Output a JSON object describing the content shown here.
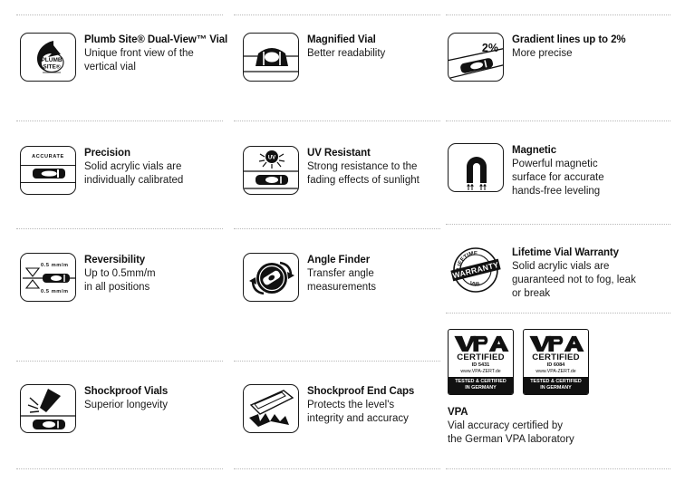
{
  "page": {
    "title": "Level Product Feature Icons",
    "columns": 3,
    "background_color": "#ffffff",
    "ink_color": "#111111",
    "separator_color": "#b9b9b9"
  },
  "features": [
    {
      "id": "plumb-site-dual-view-vial",
      "icon_name": "plumb-site-logo-icon",
      "icon_text": "PLUMB SITE",
      "title": "Plumb Site® Dual-View™ Vial",
      "desc_lines": [
        "Unique front view of the",
        "vertical vial"
      ]
    },
    {
      "id": "magnified-vial",
      "icon_name": "magnified-vial-icon",
      "icon_text": "",
      "title": "Magnified Vial",
      "desc_lines": [
        "Better readability"
      ]
    },
    {
      "id": "gradient-lines",
      "icon_name": "gradient-lines-icon",
      "icon_text": "2%",
      "title": "Gradient lines up to 2%",
      "desc_lines": [
        "More precise"
      ]
    },
    {
      "id": "precision",
      "icon_name": "accurate-vial-icon",
      "icon_text": "ACCURATE",
      "title": "Precision",
      "desc_lines": [
        "Solid acrylic vials are",
        "individually calibrated"
      ]
    },
    {
      "id": "uv-resistant",
      "icon_name": "uv-sun-icon",
      "icon_text": "UV",
      "title": "UV Resistant",
      "desc_lines": [
        "Strong resistance to the",
        "fading effects of sunlight"
      ]
    },
    {
      "id": "magnetic",
      "icon_name": "horseshoe-magnet-icon",
      "icon_text": "",
      "title": "Magnetic",
      "desc_lines": [
        "Powerful magnetic",
        "surface for accurate",
        "hands-free leveling"
      ]
    },
    {
      "id": "reversibility",
      "icon_name": "reversibility-vial-icon",
      "icon_text_top": "0.5 mm/m",
      "icon_text_bottom": "0.5 mm/m",
      "title": "Reversibility",
      "desc_lines": [
        "Up to 0.5mm/m",
        "in all positions"
      ]
    },
    {
      "id": "angle-finder",
      "icon_name": "angle-finder-dial-icon",
      "icon_text": "",
      "title": "Angle Finder",
      "desc_lines": [
        "Transfer angle",
        "measurements"
      ]
    },
    {
      "id": "lifetime-vial-warranty",
      "icon_name": "lifetime-warranty-seal-icon",
      "seal_text": {
        "top": "LIFETIME",
        "band": "WARRANTY",
        "bottom": "VIAL"
      },
      "title": "Lifetime Vial Warranty",
      "desc_lines": [
        "Solid acrylic vials are",
        "guaranteed not to fog, leak",
        "or break"
      ]
    },
    {
      "id": "shockproof-vials",
      "icon_name": "shockproof-vial-impact-icon",
      "icon_text": "",
      "title": "Shockproof Vials",
      "desc_lines": [
        "Superior longevity"
      ]
    },
    {
      "id": "shockproof-end-caps",
      "icon_name": "shockproof-end-cap-icon",
      "icon_text": "",
      "title": "Shockproof End Caps",
      "desc_lines": [
        "Protects the level's",
        "integrity and accuracy"
      ]
    },
    {
      "id": "vpa",
      "icon_name": "vpa-certified-badges-icon",
      "title": "VPA",
      "desc_lines": [
        "Vial accuracy certified by",
        "the German VPA laboratory"
      ]
    }
  ],
  "vpa_badges": [
    {
      "brand": "VPA",
      "certified": "CERTIFIED",
      "id_label": "ID 5431",
      "url": "www.VPA-ZERT.de",
      "footer_line1": "TESTED & CERTIFIED",
      "footer_line2": "IN GERMANY"
    },
    {
      "brand": "VPA",
      "certified": "CERTIFIED",
      "id_label": "ID 6084",
      "url": "www.VPA-ZERT.de",
      "footer_line1": "TESTED & CERTIFIED",
      "footer_line2": "IN GERMANY"
    }
  ]
}
